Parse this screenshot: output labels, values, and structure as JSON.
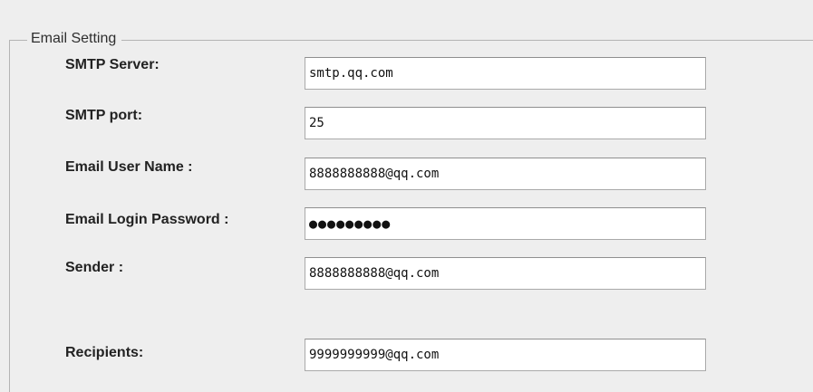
{
  "group": {
    "legend": "Email Setting"
  },
  "fields": {
    "smtp_server": {
      "label": "SMTP Server:",
      "value": "smtp.qq.com"
    },
    "smtp_port": {
      "label": "SMTP port:",
      "value": "25"
    },
    "email_user_name": {
      "label": "Email User Name :",
      "value": "8888888888@qq.com"
    },
    "email_login_password": {
      "label": "Email Login Password :",
      "value": "●●●●●●●●●"
    },
    "sender": {
      "label": "Sender :",
      "value": "8888888888@qq.com"
    },
    "recipients": {
      "label": "Recipients:",
      "value": "9999999999@qq.com"
    }
  }
}
